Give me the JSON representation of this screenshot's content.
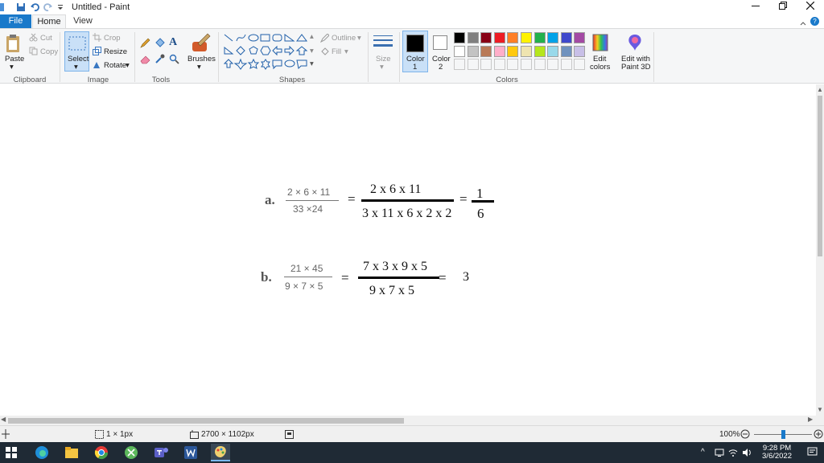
{
  "window": {
    "title": "Untitled - Paint"
  },
  "tabs": {
    "file": "File",
    "home": "Home",
    "view": "View"
  },
  "ribbon": {
    "clipboard": {
      "paste": "Paste",
      "cut": "Cut",
      "copy": "Copy",
      "group": "Clipboard"
    },
    "image": {
      "select": "Select",
      "crop": "Crop",
      "resize": "Resize",
      "rotate": "Rotate",
      "group": "Image"
    },
    "tools": {
      "group": "Tools"
    },
    "brushes": {
      "label": "Brushes"
    },
    "shapes": {
      "outline": "Outline",
      "fill": "Fill",
      "group": "Shapes"
    },
    "size": {
      "label": "Size"
    },
    "color1": {
      "line1": "Color",
      "line2": "1"
    },
    "color2": {
      "line1": "Color",
      "line2": "2"
    },
    "edit_colors": {
      "line1": "Edit",
      "line2": "colors"
    },
    "paint3d": {
      "line1": "Edit with",
      "line2": "Paint 3D"
    },
    "colors_group": "Colors",
    "palette_row1": [
      "#000000",
      "#7f7f7f",
      "#880015",
      "#ed1c24",
      "#ff7f27",
      "#fff200",
      "#22b14c",
      "#00a2e8",
      "#3f48cc",
      "#a349a4"
    ],
    "palette_row2": [
      "#ffffff",
      "#c3c3c3",
      "#b97a57",
      "#ffaec9",
      "#ffc90e",
      "#efe4b0",
      "#b5e61d",
      "#99d9ea",
      "#7092be",
      "#c8bfe7"
    ]
  },
  "canvas": {
    "a": {
      "label": "a.",
      "num_small": "2 × 6 × 11",
      "den_small": "33 ×24",
      "eq1": "=",
      "num_big": "2 x 6 x 11",
      "den_big": "3 x 11 x 6 x 2 x 2",
      "eq2": "=",
      "res_num": "1",
      "res_den": "6"
    },
    "b": {
      "label": "b.",
      "num_small": "21 × 45",
      "den_small": "9 × 7 × 5",
      "eq1": "=",
      "num_big": "7 x 3 x 9 x 5",
      "den_big": "9 x 7 x 5",
      "eq2": "=",
      "result": "3"
    }
  },
  "status": {
    "selection": "1 × 1px",
    "image_size": "2700 × 1102px",
    "zoom": "100%",
    "zoom_level": 0.5
  },
  "taskbar": {
    "time": "9:28 PM",
    "date": "3/6/2022"
  }
}
